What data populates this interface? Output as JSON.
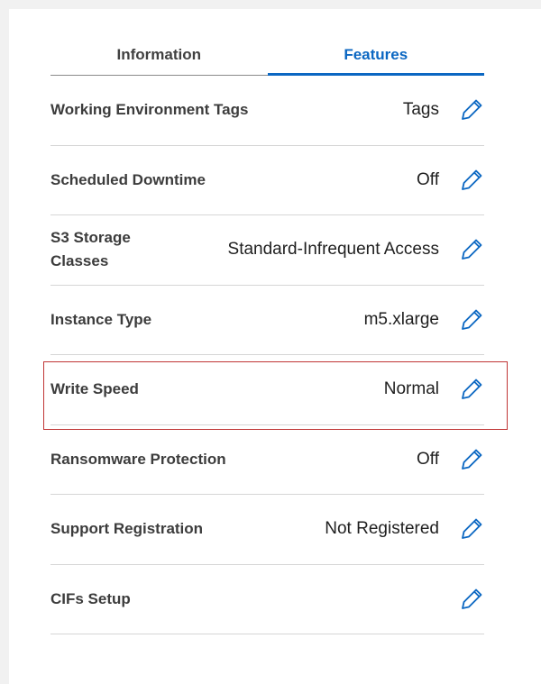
{
  "tabs": [
    {
      "label": "Information",
      "active": false
    },
    {
      "label": "Features",
      "active": true
    }
  ],
  "rows": [
    {
      "label": "Working Environment Tags",
      "value": "Tags"
    },
    {
      "label": "Scheduled Downtime",
      "value": "Off"
    },
    {
      "label": "S3 Storage Classes",
      "value": "Standard-Infrequent Access"
    },
    {
      "label": "Instance Type",
      "value": "m5.xlarge"
    },
    {
      "label": "Write Speed",
      "value": "Normal"
    },
    {
      "label": "Ransomware Protection",
      "value": "Off"
    },
    {
      "label": "Support Registration",
      "value": "Not Registered"
    },
    {
      "label": "CIFs Setup",
      "value": ""
    }
  ],
  "icons": {
    "edit": "pencil-icon"
  },
  "colors": {
    "accent": "#0b67c2",
    "highlight_border": "#c03535",
    "divider": "#d6d6d6"
  }
}
